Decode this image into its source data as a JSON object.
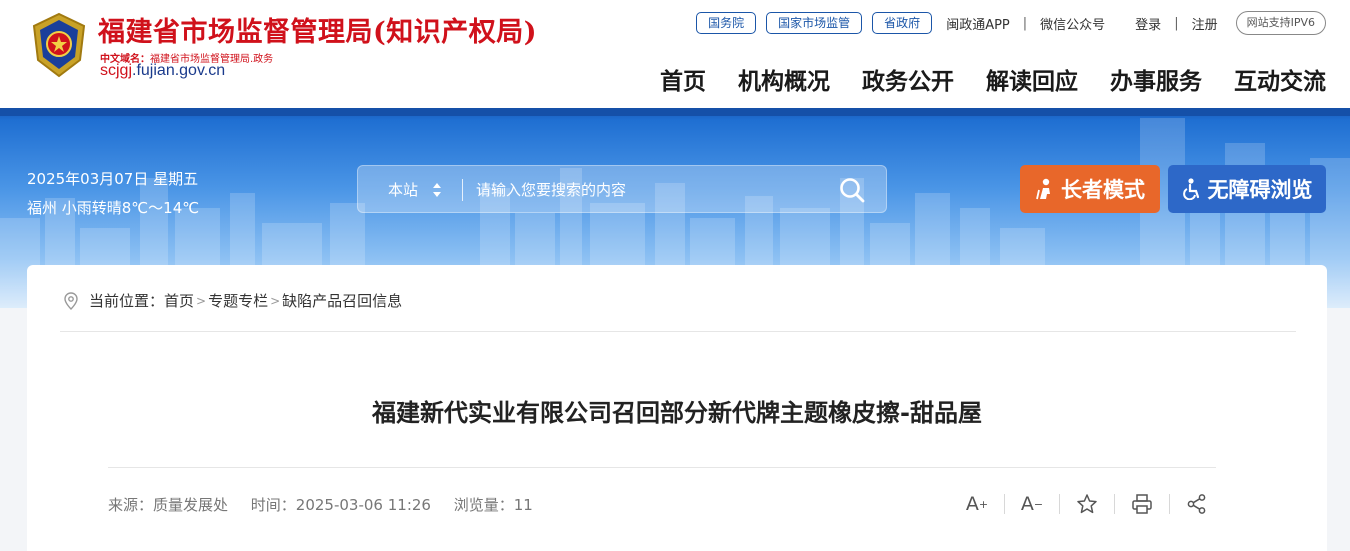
{
  "header": {
    "site_title": "福建省市场监督管理局(知识产权局)",
    "cn_domain_label": "中文域名：",
    "cn_domain_value": "福建省市场监督管理局.政务",
    "domain_red": "scjgj",
    "domain_rest": ".fujian.gov.cn",
    "top_pills": [
      "国务院",
      "国家市场监管",
      "省政府"
    ],
    "app_link": "闽政通APP",
    "wechat_link": "微信公众号",
    "login": "登录",
    "register": "注册",
    "ipv6": "网站支持IPV6",
    "nav": [
      "首页",
      "机构概况",
      "政务公开",
      "解读回应",
      "办事服务",
      "互动交流"
    ]
  },
  "banner": {
    "date": "2025年03月07日 星期五",
    "weather": "福州 小雨转晴8℃～14℃",
    "search_scope": "本站",
    "search_placeholder": "请输入您要搜索的内容",
    "elder_mode": "长者模式",
    "accessibility": "无障碍浏览"
  },
  "breadcrumb": {
    "label": "当前位置：",
    "items": [
      "首页",
      "专题专栏",
      "缺陷产品召回信息"
    ]
  },
  "article": {
    "title": "福建新代实业有限公司召回部分新代牌主题橡皮擦-甜品屋",
    "source": "来源：质量发展处",
    "time": "时间：2025-03-06 11:26",
    "views": "浏览量：11"
  },
  "tools": {
    "font_up": "A",
    "font_down": "A"
  },
  "colors": {
    "brand_red": "#d0111b",
    "nav_blue": "#1b56a8",
    "elder_orange": "#e8672a",
    "access_blue": "#2d68c8"
  }
}
